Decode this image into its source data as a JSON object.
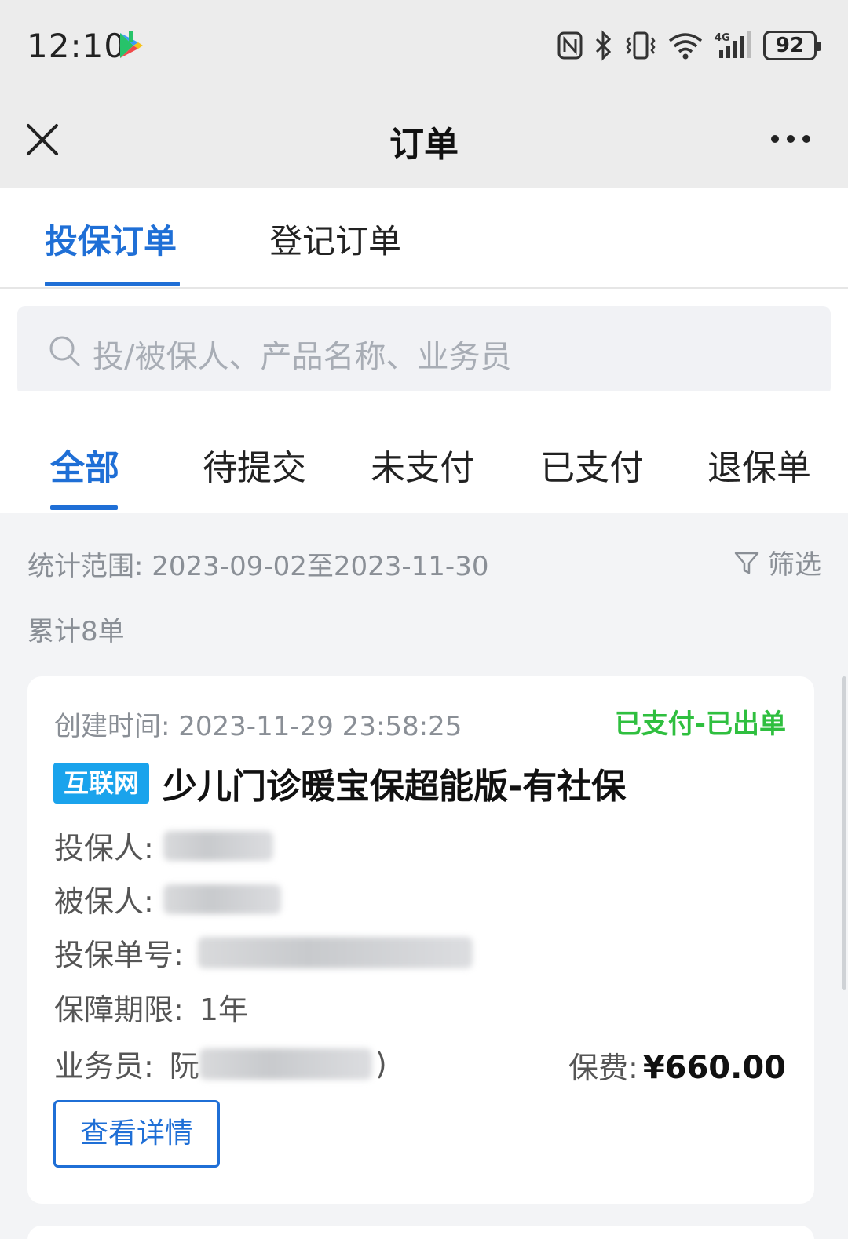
{
  "status_bar": {
    "time": "12:10",
    "battery": "92",
    "icons": [
      "play-store-icon",
      "nfc-icon",
      "bluetooth-icon",
      "vibrate-icon",
      "wifi-icon",
      "signal-4g-icon",
      "battery-icon"
    ]
  },
  "nav": {
    "title": "订单"
  },
  "top_tabs": [
    {
      "label": "投保订单",
      "active": true
    },
    {
      "label": "登记订单",
      "active": false
    }
  ],
  "search": {
    "placeholder": "投/被保人、产品名称、业务员"
  },
  "status_tabs": [
    {
      "label": "全部",
      "active": true
    },
    {
      "label": "待提交",
      "active": false
    },
    {
      "label": "未支付",
      "active": false
    },
    {
      "label": "已支付",
      "active": false
    },
    {
      "label": "退保单",
      "active": false
    }
  ],
  "stats": {
    "range_label": "统计范围:",
    "range_value": "2023-09-02至2023-11-30",
    "count_text": "累计8单",
    "filter_label": "筛选"
  },
  "order": {
    "created_label": "创建时间:",
    "created_time": "2023-11-29 23:58:25",
    "status": "已支付-已出单",
    "badge": "互联网",
    "product": "少儿门诊暖宝保超能版-有社保",
    "applicant_label": "投保人:",
    "insured_label": "被保人:",
    "policy_no_label": "投保单号:",
    "term_label": "保障期限:",
    "term_value": "1年",
    "agent_label": "业务员:",
    "agent_prefix": "阮",
    "agent_suffix": ")",
    "premium_label": "保费:",
    "premium_value": "¥660.00",
    "detail_button": "查看详情"
  },
  "colors": {
    "accent": "#1f6fd6",
    "status_green": "#2fbf3f",
    "badge_blue": "#1aa3ec"
  }
}
